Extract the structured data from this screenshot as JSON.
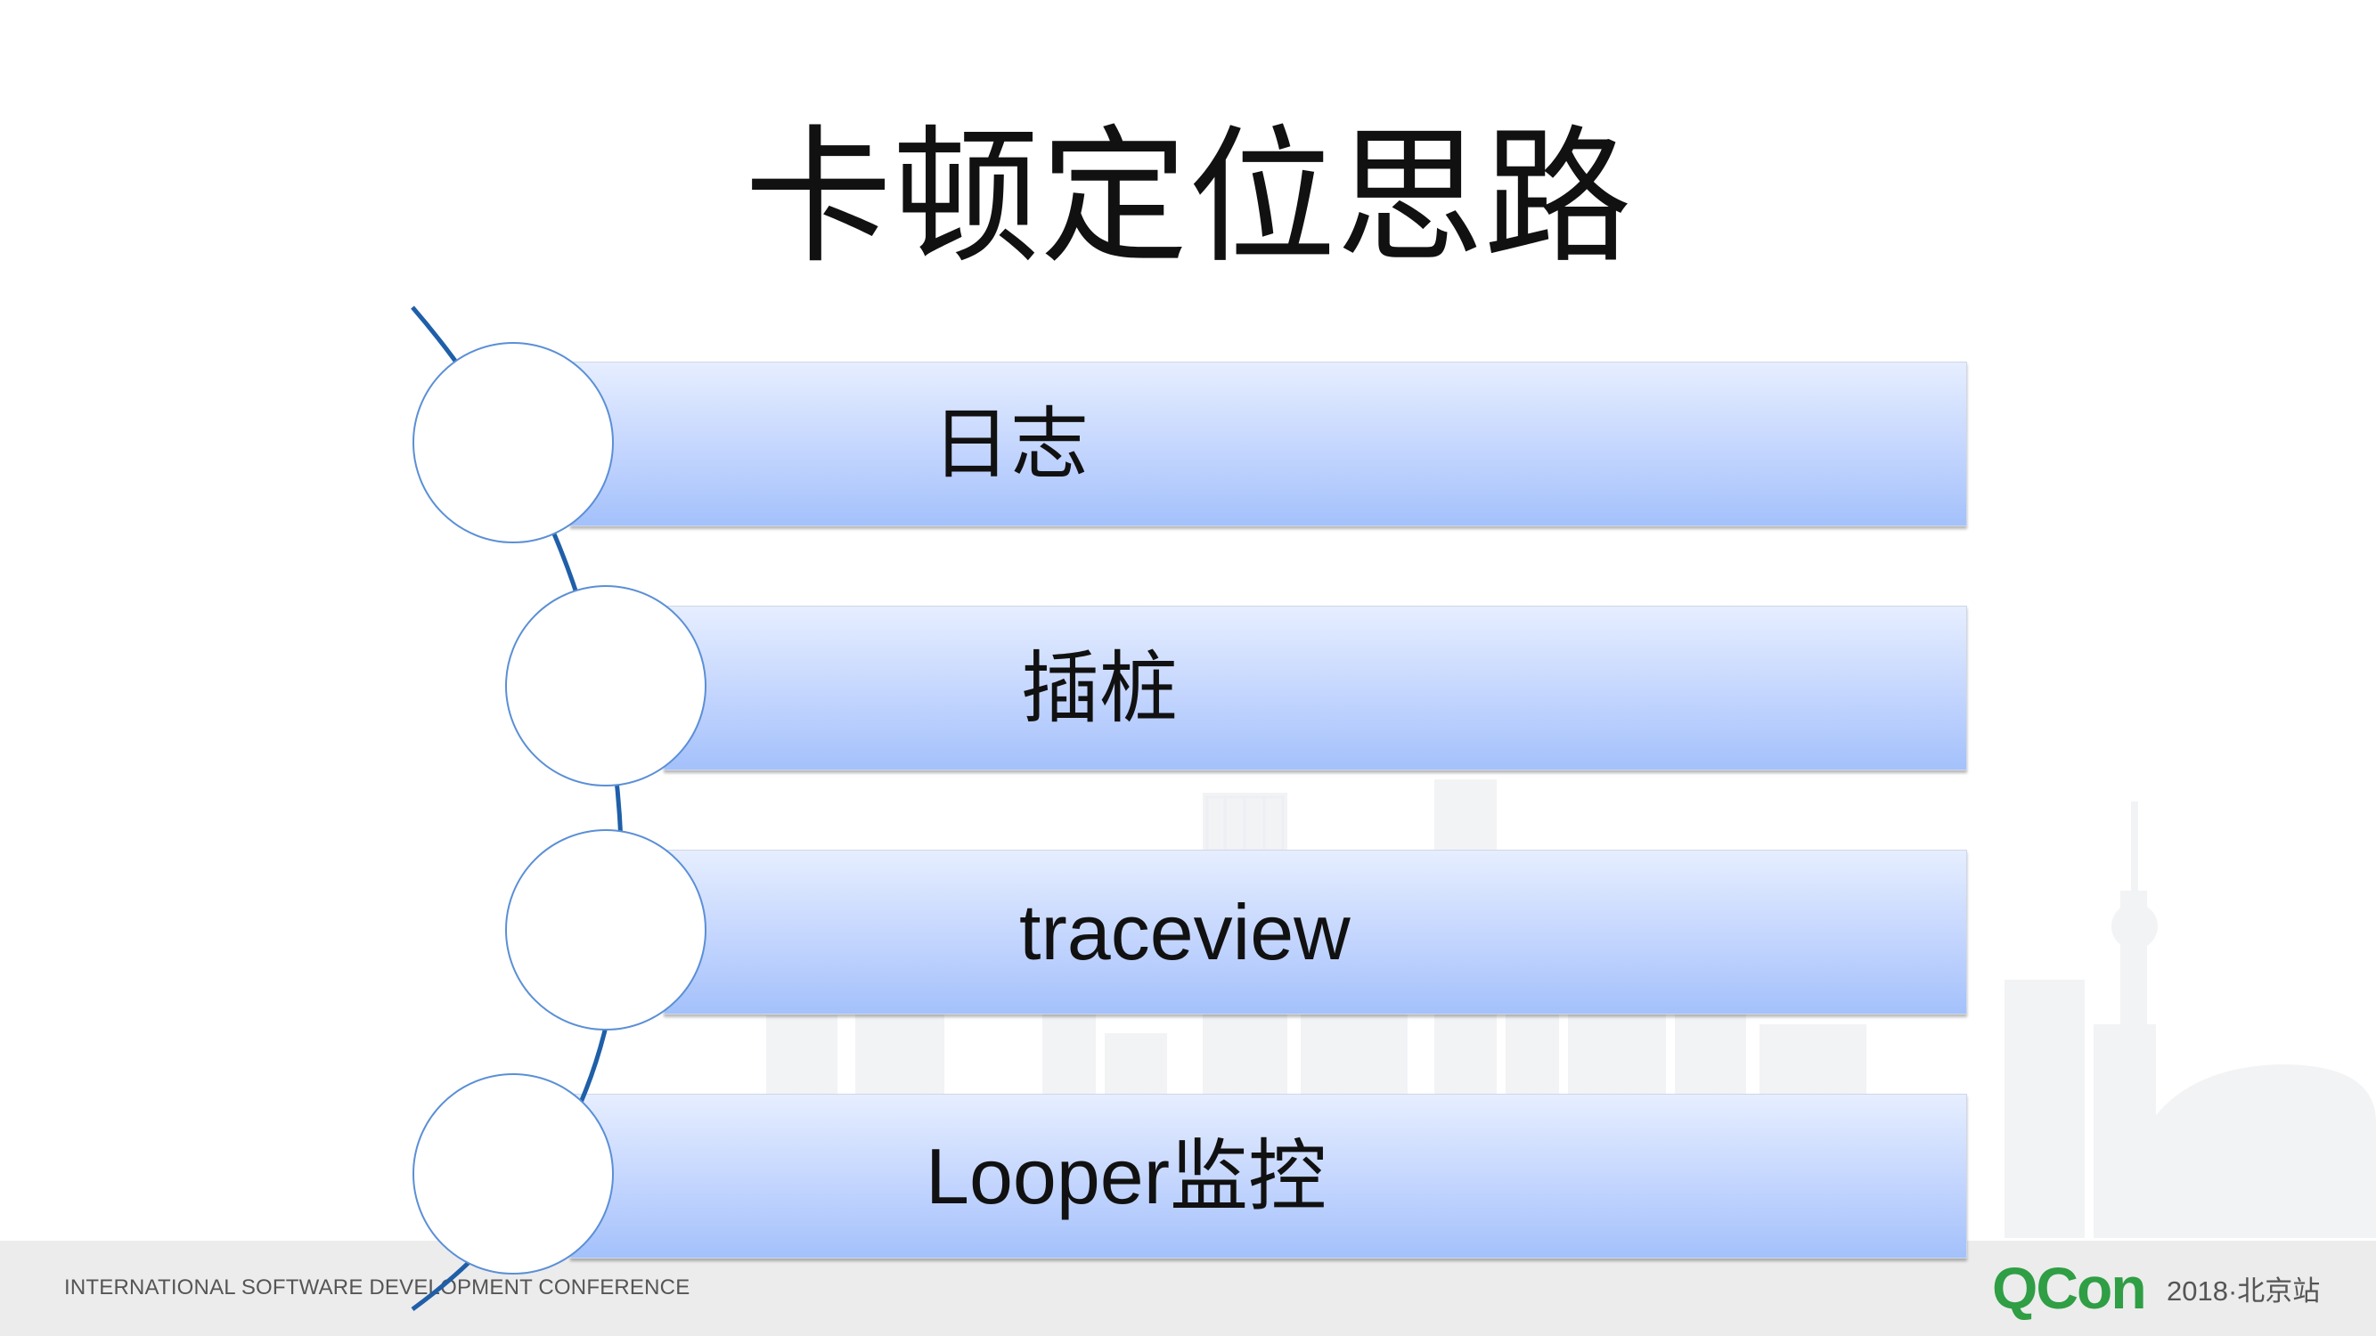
{
  "slide": {
    "title": "卡顿定位思路",
    "items": [
      {
        "label": "日志"
      },
      {
        "label": "插桩"
      },
      {
        "label": "traceview"
      },
      {
        "label": "Looper监控"
      }
    ]
  },
  "footer": {
    "conference": "INTERNATIONAL SOFTWARE DEVELOPMENT CONFERENCE",
    "logo": "QCon",
    "edition": "2018·北京站"
  },
  "colors": {
    "title": "#111111",
    "bar_top": "#e6eeff",
    "bar_bottom": "#a4c1fb",
    "circle_border": "#5b8fd6",
    "connector": "#1f5fa8",
    "logo": "#2f9e44",
    "footer_bg": "#ececec"
  },
  "icons": [
    "skyline-illustration",
    "connector-curve"
  ]
}
